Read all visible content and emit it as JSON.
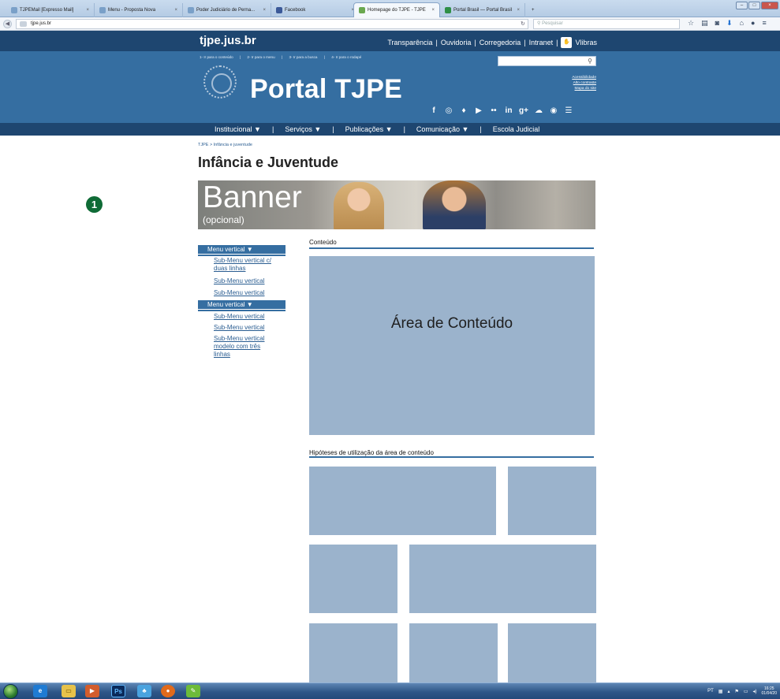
{
  "browser": {
    "tabs": [
      {
        "label": "TJPEMail [Expresso Mail]"
      },
      {
        "label": "Menu - Proposta Nova"
      },
      {
        "label": "Poder Judiciário de Perna..."
      },
      {
        "label": "Facebook"
      },
      {
        "label": "Homepage do TJPE - TJPE"
      },
      {
        "label": "Portal Brasil — Portal Brasil"
      }
    ],
    "new_tab": "+",
    "url": "tjpe.jus.br",
    "search_placeholder": "Pesquisar"
  },
  "header": {
    "site_name": "tjpe.jus.br",
    "top_links": [
      "Transparência",
      "Ouvidoria",
      "Corregedoria",
      "Intranet"
    ],
    "separator": "|",
    "vlibras_label": "Vlibras",
    "skip_links": [
      "1- Ir para o conteúdo",
      "2- Ir para o menu",
      "3- Ir para a busca",
      "4- Ir para o rodapé"
    ],
    "portal_title": "Portal TJPE",
    "accessibility_links": [
      "Acessibilidade",
      "Alto contraste",
      "Mapa do site"
    ],
    "social_icons": [
      "facebook-icon",
      "instagram-icon",
      "twitter-icon",
      "youtube-icon",
      "flickr-icon",
      "linkedin-icon",
      "googleplus-icon",
      "soundcloud-icon",
      "periscope-icon",
      "rss-icon"
    ]
  },
  "nav": {
    "items": [
      "Institucional",
      "Serviços",
      "Publicações",
      "Comunicação",
      "Escola Judicial"
    ],
    "dropdown_marker": "▼"
  },
  "breadcrumb": "TJPE > Infância e juventude",
  "page_title": "Infância e Juventude",
  "banner": {
    "title": "Banner",
    "subtitle": "(opcional)"
  },
  "sidebar": {
    "menu1": {
      "label": "Menu vertical  ▼",
      "items": [
        "Sub-Menu vertical c/ duas linhas",
        "Sub-Menu vertical",
        "Sub-Menu vertical"
      ]
    },
    "menu2": {
      "label": "Menu vertical  ▼",
      "items": [
        "Sub-Menu vertical",
        "Sub-Menu vertical",
        "Sub-Menu vertical modelo com três linhas"
      ]
    }
  },
  "content": {
    "label": "Conteúdo",
    "area_label": "Área de Conteúdo",
    "hypotheses_label": "Hipóteses de utilização da área de conteúdo"
  },
  "annotation_marker": "1",
  "taskbar": {
    "lang": "PT",
    "time": "16:25",
    "date": "01/04/20"
  },
  "colors": {
    "header_dark": "#1e4670",
    "header": "#356ea1",
    "placeholder_box": "#9bb3cc",
    "link": "#2a5d91"
  }
}
